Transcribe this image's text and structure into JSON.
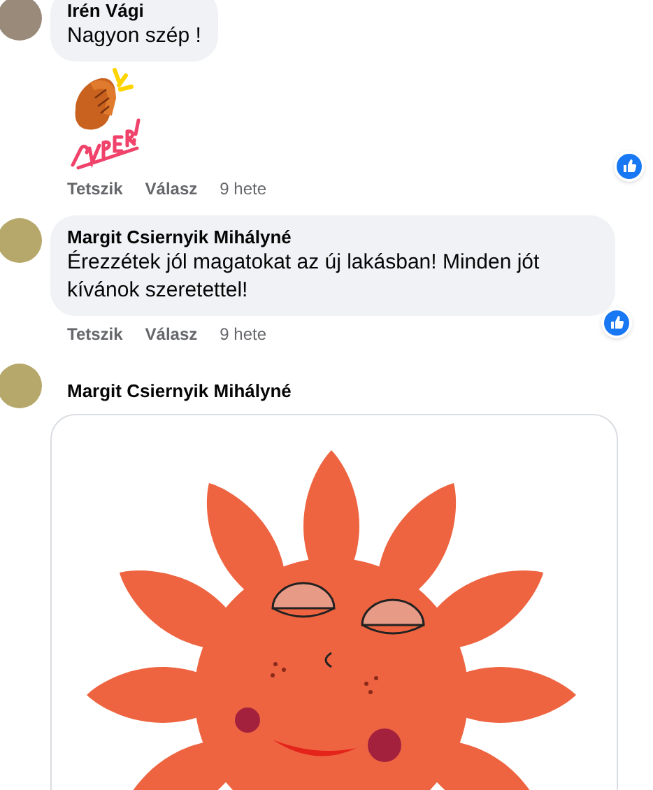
{
  "comments": [
    {
      "author": "Irén Vági",
      "text": "Nagyon szép !",
      "kind": "sticker",
      "liked": true,
      "actions": [
        "Tetszik",
        "Válasz"
      ],
      "time": "9 hete"
    },
    {
      "author": "Margit Csiernyik Mihályné",
      "text": "Érezzétek jól magatokat az új lakásban! Minden jót kívánok szeretettel!",
      "kind": "text",
      "liked": true,
      "actions": [
        "Tetszik",
        "Válasz"
      ],
      "time": "9 hete"
    },
    {
      "author": "Margit Csiernyik Mihályné",
      "kind": "image"
    }
  ]
}
